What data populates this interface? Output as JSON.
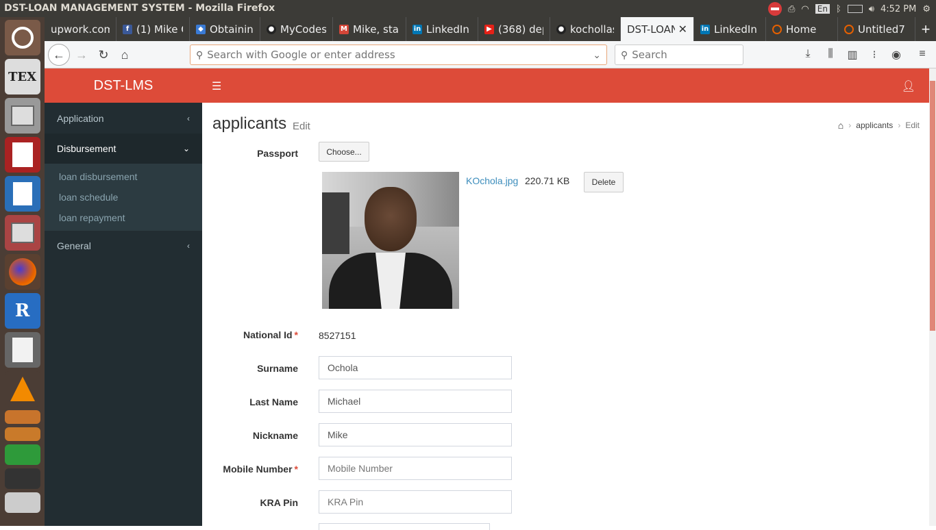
{
  "window_title": "DST-LOAN MANAGEMENT SYSTEM - Mozilla Firefox",
  "system_tray": {
    "keyboard_layout": "En",
    "clock": "4:52 PM"
  },
  "launcher": {
    "apps": [
      "ubuntu-dash",
      "texmaker",
      "files",
      "evince",
      "writer",
      "files",
      "firefox",
      "r",
      "text-editor",
      "vlc",
      "amazon",
      "impress",
      "calc",
      "screenshot",
      "drive"
    ],
    "tex_label": "TEX",
    "r_label": "R"
  },
  "tabs": [
    {
      "label": "upwork.com",
      "icon": "upwork-icon"
    },
    {
      "label": "(1) Mike O",
      "icon": "facebook-icon"
    },
    {
      "label": "Obtainin",
      "icon": "shield-icon"
    },
    {
      "label": "MyCodes",
      "icon": "github-icon"
    },
    {
      "label": "Mike, sta",
      "icon": "gmail-icon"
    },
    {
      "label": "LinkedIn",
      "icon": "linkedin-icon"
    },
    {
      "label": "(368) dep",
      "icon": "youtube-icon"
    },
    {
      "label": "kochollas",
      "icon": "github-icon"
    },
    {
      "label": "DST-LOAN",
      "icon": "",
      "active": true
    },
    {
      "label": "LinkedIn",
      "icon": "linkedin-icon"
    },
    {
      "label": "Home",
      "icon": "loading-icon"
    },
    {
      "label": "Untitled7",
      "icon": "loading-icon"
    }
  ],
  "newtab_label": "+",
  "urlbar": {
    "placeholder": "Search with Google or enter address"
  },
  "searchbar": {
    "placeholder": "Search"
  },
  "sidebar": {
    "brand": "DST-LMS",
    "menus": [
      {
        "label": "Application",
        "arrow": "<"
      },
      {
        "label": "Disbursement",
        "arrow": "v",
        "open": true,
        "items": [
          "loan disbursement",
          "loan schedule",
          "loan repayment"
        ]
      },
      {
        "label": "General",
        "arrow": "<"
      }
    ]
  },
  "page": {
    "title": "applicants",
    "subtitle": "Edit",
    "breadcrumb": [
      "applicants",
      "Edit"
    ]
  },
  "form": {
    "passport": {
      "label": "Passport",
      "choose_label": "Choose...",
      "file_name": "KOchola.jpg",
      "file_size": "220.71 KB",
      "delete_label": "Delete"
    },
    "national_id": {
      "label": "National Id",
      "value": "8527151",
      "required": "*"
    },
    "surname": {
      "label": "Surname",
      "value": "Ochola"
    },
    "last_name": {
      "label": "Last Name",
      "value": "Michael"
    },
    "nickname": {
      "label": "Nickname",
      "value": "Mike"
    },
    "mobile_number": {
      "label": "Mobile Number",
      "placeholder": "Mobile Number",
      "required": "*"
    },
    "kra_pin": {
      "label": "KRA Pin",
      "placeholder": "KRA Pin"
    }
  },
  "colors": {
    "brand": "#dd4b39",
    "sidebar": "#222d32",
    "link": "#3c8dbc"
  }
}
